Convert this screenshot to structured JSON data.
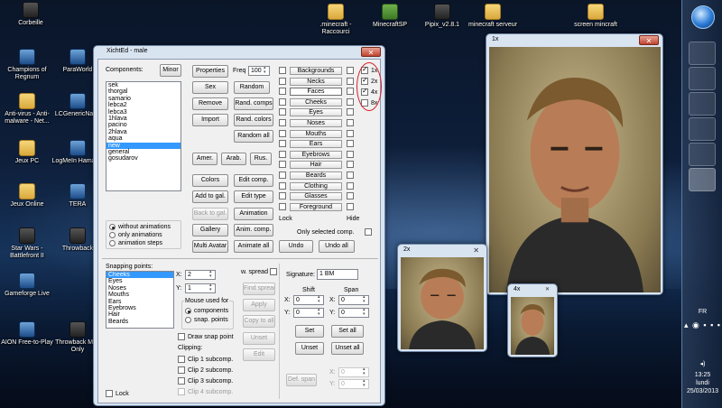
{
  "desktop": {
    "icons": [
      {
        "label": "Corbeille",
        "kind": "recycle-bin-icon"
      },
      {
        "label": "Champions of Regnum",
        "kind": "game-icon"
      },
      {
        "label": "ParaWorld",
        "kind": "game-icon"
      },
      {
        "label": "Anti-virus - Anti-malware - Net...",
        "kind": "folder-icon"
      },
      {
        "label": "LCGenericNat...",
        "kind": "app-icon"
      },
      {
        "label": "Jeux PC",
        "kind": "folder-icon"
      },
      {
        "label": "LogMeIn Hamachi",
        "kind": "app-icon"
      },
      {
        "label": "Jeux Online",
        "kind": "folder-icon"
      },
      {
        "label": "TERA",
        "kind": "game-icon"
      },
      {
        "label": "Star Wars - Battlefront II",
        "kind": "game-icon"
      },
      {
        "label": "Throwback",
        "kind": "game-icon"
      },
      {
        "label": "Gameforge Live",
        "kind": "app-icon"
      },
      {
        "label": "AION Free-to-Play",
        "kind": "game-icon"
      },
      {
        "label": "Throwback Mod Only",
        "kind": "game-icon"
      },
      {
        "label": ".minecraft - Raccourci",
        "kind": "folder-icon"
      },
      {
        "label": "MinecraftSP",
        "kind": "app-icon"
      },
      {
        "label": "Pipix_v2.8.1",
        "kind": "app-icon"
      },
      {
        "label": "minecraft serveur",
        "kind": "folder-icon"
      },
      {
        "label": "screen mincraft",
        "kind": "folder-icon"
      }
    ]
  },
  "taskbar": {
    "lang": "FR",
    "time": "13:25",
    "day": "lundi",
    "date": "25/03/2013"
  },
  "main_window": {
    "title": "XichtEd - male",
    "components_label": "Components:",
    "minor_btn": "Minor",
    "components": [
      "sek",
      "thorgal",
      "samario",
      "lebca2",
      "lebca3",
      "1hlava",
      "pacino",
      "2hlava",
      "aqua",
      "new",
      "general",
      "gosudarov"
    ],
    "selected_component": "new",
    "properties_btn": "Properties",
    "freq_label": "Freq",
    "freq_value": "100",
    "sex_btn": "Sex",
    "random_btn": "Random",
    "remove_btn": "Remove",
    "rand_comps_btn": "Rand. comps",
    "import_btn": "Import",
    "rand_colors_btn": "Rand. colors",
    "random_all_btn": "Random all",
    "amer_btn": "Amer.",
    "arab_btn": "Arab.",
    "rus_btn": "Rus.",
    "colors_btn": "Colors",
    "edit_comp_btn": "Edit comp.",
    "add_to_gal_btn": "Add to gal.",
    "edit_type_btn": "Edit type",
    "back_to_gal_btn": "Back to gal.",
    "animation_btn": "Animation",
    "gallery_btn": "Gallery",
    "anim_comp_btn": "Anim. comp.",
    "multi_avatar_btn": "Multi Avatar",
    "animate_all_btn": "Animate all",
    "undo_btn": "Undo",
    "undo_all_btn": "Undo all",
    "anim_modes": [
      "without animations",
      "only animations",
      "animation steps"
    ],
    "features": [
      "Backgrounds",
      "Necks",
      "Faces",
      "Cheeks",
      "Eyes",
      "Noses",
      "Mouths",
      "Ears",
      "Eyebrows",
      "Hair",
      "Beards",
      "Clothing",
      "Glasses",
      "Foreground"
    ],
    "lock_label": "Lock",
    "hide_label": "Hide",
    "only_selected_label": "Only selected comp.",
    "zoom_options": [
      "1x",
      "2x",
      "4x",
      "8x"
    ],
    "snapping_label": "Snapping points:",
    "snapping_points": [
      "Cheeks",
      "Eyes",
      "Noses",
      "Mouths",
      "Ears",
      "Eyebrows",
      "Hair",
      "Beards"
    ],
    "x_label": "X:",
    "x_value": "2",
    "y_label": "Y:",
    "y_value": "1",
    "w_spread_label": "w. spread",
    "mouse_used_label": "Mouse used for",
    "mouse_modes": [
      "components",
      "snap. points"
    ],
    "find_spread_btn": "Find spread",
    "apply_btn": "Apply",
    "copy_to_all_btn": "Copy to all",
    "unset_btn": "Unset",
    "edit_btn": "Edit",
    "draw_snap_label": "Draw snap point",
    "clipping_label": "Clipping:",
    "clips": [
      "Clip 1 subcomp.",
      "Clip 2 subcomp.",
      "Clip 3 subcomp.",
      "Clip 4 subcomp."
    ],
    "lock_bottom_label": "Lock",
    "signature_label": "Signature:",
    "signature_value": "1 BM",
    "shift_label": "Shift",
    "span_label": "Span",
    "shift_x": "0",
    "shift_y": "0",
    "span_x": "0",
    "span_y": "0",
    "set_btn": "Set",
    "set_all_btn": "Set all",
    "unset2_btn": "Unset",
    "unset_all_btn": "Unset all",
    "def_span_btn": "Def. span",
    "def_x": "0",
    "def_y": "0"
  },
  "preview_1x": {
    "title": "1x"
  },
  "preview_2x": {
    "title": "2x"
  },
  "preview_4x": {
    "title": "4x"
  }
}
